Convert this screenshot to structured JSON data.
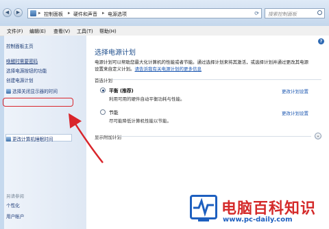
{
  "address": {
    "crumbs": [
      "控制面板",
      "硬件和声音",
      "电源选项"
    ],
    "search_placeholder": "搜索控制面板"
  },
  "menu": [
    "文件(F)",
    "编辑(E)",
    "查看(V)",
    "工具(T)",
    "帮助(H)"
  ],
  "sidebar": {
    "home": "控制面板主页",
    "links": [
      "唤醒时需要密码",
      "选择电源按钮的功能",
      "创建电源计划",
      "选择关闭显示器的时间",
      "更改计算机睡眠时间"
    ],
    "see_also": "另请参阅",
    "bottom": [
      "个性化",
      "用户帐户"
    ]
  },
  "main": {
    "title": "选择电源计划",
    "desc_line1": "电源计划可以帮助您最大化计算机的性能或者节能。通过选择计划来将其激活，或选择计划并通过更改其电源",
    "desc_line2_prefix": "设置来自定义计划。",
    "desc_link": "请告诉我有关电源计划的更多信息",
    "section_label": "首选计划",
    "plans": [
      {
        "name": "平衡 (推荐)",
        "desc": "利用可用的硬件自动平衡功耗与性能。",
        "selected": true,
        "change": "更改计划设置"
      },
      {
        "name": "节能",
        "desc": "尽可能降低计算机性能以节能。",
        "selected": false,
        "change": "更改计划设置"
      }
    ],
    "more_plans": "显示附加计划"
  },
  "watermark": {
    "brand": "电脑百科知识",
    "url": "www.pc-daily.com"
  },
  "colors": {
    "accent": "#1e4e8c",
    "link": "#1a56b0",
    "annotation": "#d9252b"
  }
}
